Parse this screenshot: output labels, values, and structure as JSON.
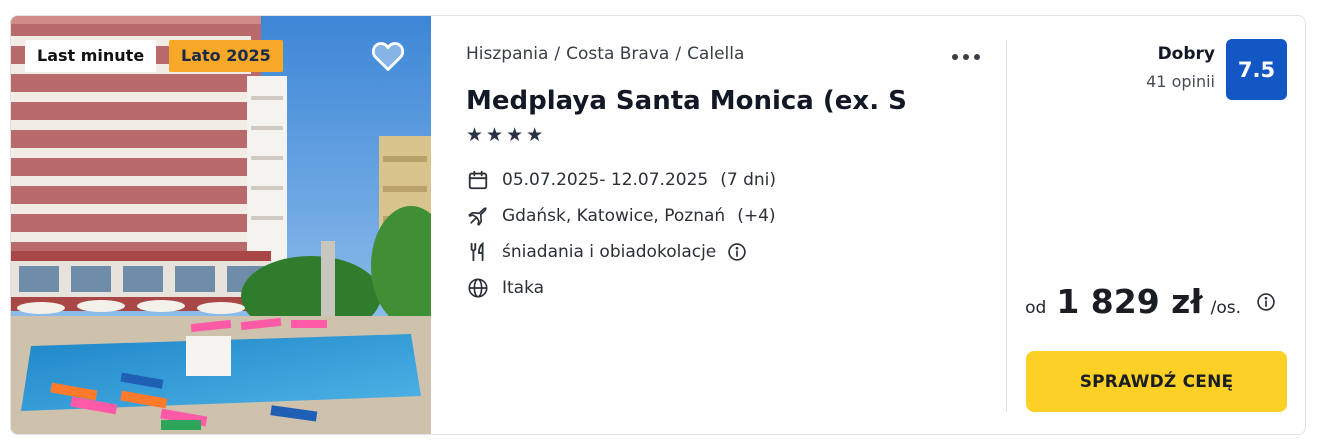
{
  "badges": {
    "last_minute": "Last minute",
    "season": "Lato 2025"
  },
  "breadcrumb": [
    "Hiszpania",
    "Costa Brava",
    "Calella"
  ],
  "breadcrumb_separator": "/",
  "hotel": {
    "name": "Medplaya Santa Monica (ex. S...",
    "stars": 4,
    "star_glyph": "★"
  },
  "details": {
    "dates": "05.07.2025- 12.07.2025",
    "duration": "(7 dni)",
    "departure": "Gdańsk, Katowice, Poznań",
    "departure_more": "(+4)",
    "board": "śniadania i obiadokolacje",
    "operator": "Itaka"
  },
  "rating": {
    "label": "Dobry",
    "reviews": "41 opinii",
    "score": "7.5"
  },
  "price": {
    "prefix": "od",
    "amount": "1 829 zł",
    "suffix": "/os."
  },
  "cta_label": "SPRAWDŹ CENĘ",
  "colors": {
    "score_bg": "#1357c5",
    "cta_bg": "#fcd025",
    "season_badge_bg": "#f7a826"
  },
  "icons": {
    "favorite": "heart-icon",
    "more": "more-dots-icon",
    "dates": "calendar-icon",
    "departure": "plane-icon",
    "board": "cutlery-icon",
    "board_info": "info-icon",
    "operator": "globe-icon",
    "price_info": "info-icon"
  }
}
